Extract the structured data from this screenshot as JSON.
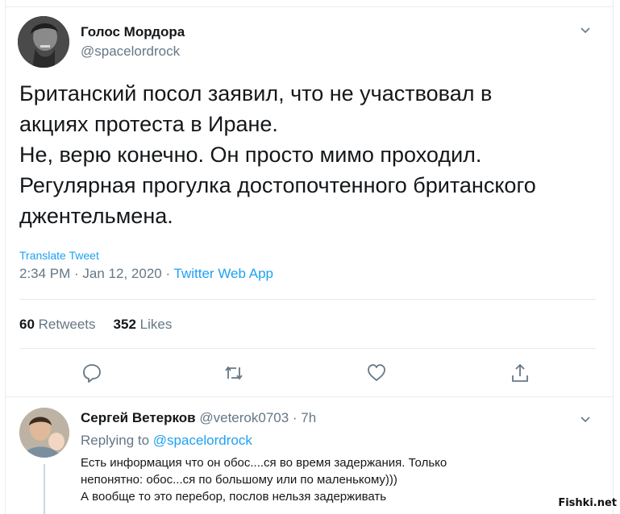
{
  "tweet": {
    "author_name": "Голос Мордора",
    "author_handle": "@spacelordrock",
    "text": "Британский посол заявил, что не участвовал в\nакциях протеста в Иране.\nНе, верю конечно. Он просто мимо проходил.\nРегулярная прогулка достопочтенного британского\nджентельмена.",
    "translate_label": "Translate Tweet",
    "timestamp": "2:34 PM · Jan 12, 2020 · ",
    "source_app": "Twitter Web App",
    "retweets_count": "60",
    "retweets_label": "Retweets",
    "likes_count": "352",
    "likes_label": "Likes",
    "icons": [
      "reply-icon",
      "retweet-icon",
      "like-icon",
      "share-icon",
      "chevron-down-icon"
    ]
  },
  "reply": {
    "author_name": "Сергей Ветерков",
    "author_handle": "@veterok0703",
    "time": " · 7h",
    "replying_label": "Replying to ",
    "replying_to": "@spacelordrock",
    "text": "Есть информация что он обос....ся во время задержания. Только\nнепонятно: обос...ся по большому  или по маленькому)))\nА вообще то это перебор, послов нельзя задерживать"
  },
  "watermark": "Fishki.net",
  "colors": {
    "accent": "#1da1f2",
    "secondary_text": "#657786",
    "primary_text": "#14171a",
    "border": "#e6ecf0"
  }
}
